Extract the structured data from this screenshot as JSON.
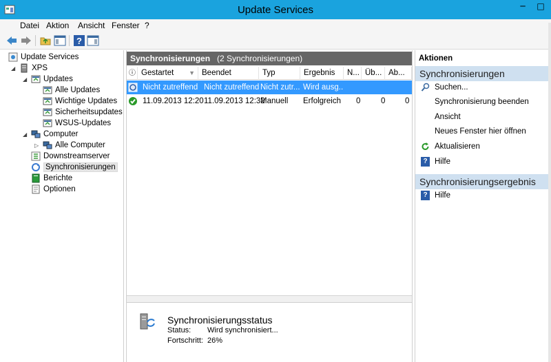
{
  "window": {
    "title": "Update Services",
    "minimize": "─",
    "maximize": "□"
  },
  "menu": [
    "Datei",
    "Aktion",
    "Ansicht",
    "Fenster",
    "?"
  ],
  "tree": [
    {
      "label": "Update Services",
      "icon": "update-services-icon"
    },
    {
      "label": "XPS",
      "icon": "server-icon"
    },
    {
      "label": "Updates",
      "icon": "updates-icon"
    },
    {
      "label": "Alle Updates",
      "icon": "updates-icon"
    },
    {
      "label": "Wichtige Updates",
      "icon": "updates-icon"
    },
    {
      "label": "Sicherheitsupdates",
      "icon": "updates-icon"
    },
    {
      "label": "WSUS-Updates",
      "icon": "updates-icon"
    },
    {
      "label": "Computer",
      "icon": "computer-icon"
    },
    {
      "label": "Alle Computer",
      "icon": "computer-icon"
    },
    {
      "label": "Downstreamserver",
      "icon": "downstream-icon"
    },
    {
      "label": "Synchronisierungen",
      "icon": "sync-icon"
    },
    {
      "label": "Berichte",
      "icon": "reports-icon"
    },
    {
      "label": "Optionen",
      "icon": "options-icon"
    }
  ],
  "center": {
    "header_title": "Synchronisierungen",
    "header_count": "(2 Synchronisierungen)",
    "columns": [
      "Gestartet",
      "Beendet",
      "Typ",
      "Ergebnis",
      "N...",
      "Üb...",
      "Ab..."
    ],
    "rows": [
      {
        "status": "sync-running",
        "started": "Nicht zutreffend",
        "ended": "Nicht zutreffend",
        "type": "Nicht zutr...",
        "result": "Wird ausg...",
        "n": "",
        "u": "",
        "a": ""
      },
      {
        "status": "success",
        "started": "11.09.2013 12:20",
        "ended": "11.09.2013 12:32",
        "type": "Manuell",
        "result": "Erfolgreich",
        "n": "0",
        "u": "0",
        "a": "0"
      }
    ],
    "status": {
      "title": "Synchronisierungsstatus",
      "status_label": "Status:",
      "status_value": "Wird synchronisiert...",
      "progress_label": "Fortschritt:",
      "progress_value": "26%"
    }
  },
  "actions": {
    "title": "Aktionen",
    "section1": "Synchronisierungen",
    "items1": [
      "Suchen...",
      "Synchronisierung beenden",
      "Ansicht",
      "Neues Fenster hier öffnen",
      "Aktualisieren",
      "Hilfe"
    ],
    "section2": "Synchronisierungsergebnis",
    "items2": [
      "Hilfe"
    ]
  },
  "colors": {
    "titlebar": "#1aa3de",
    "selection": "#3399ff",
    "section": "#cfe0f0",
    "header": "#666666"
  }
}
